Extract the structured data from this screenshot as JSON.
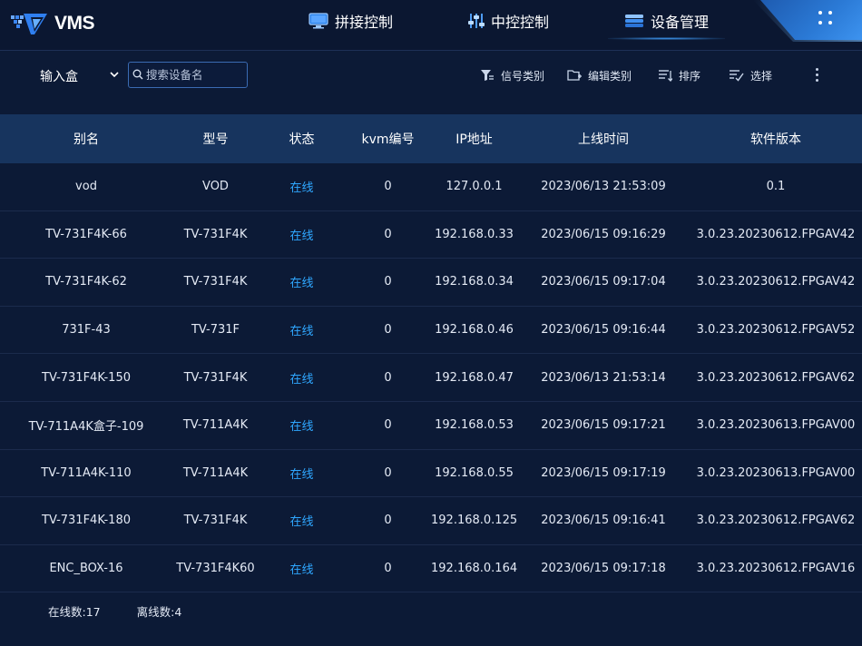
{
  "app": {
    "logo_text": "VMS"
  },
  "nav": {
    "tabs": [
      {
        "label": "拼接控制",
        "icon": "monitor-icon",
        "active": false
      },
      {
        "label": "中控控制",
        "icon": "sliders-icon",
        "active": false
      },
      {
        "label": "设备管理",
        "icon": "device-stack-icon",
        "active": true
      }
    ]
  },
  "toolbar": {
    "select_value": "输入盒",
    "search_placeholder": "搜索设备名",
    "signal_category": "信号类别",
    "edit_category": "编辑类别",
    "sort": "排序",
    "select": "选择"
  },
  "table": {
    "headers": [
      "别名",
      "型号",
      "状态",
      "kvm编号",
      "IP地址",
      "上线时间",
      "软件版本"
    ],
    "rows": [
      {
        "alias": "vod",
        "model": "VOD",
        "status": "在线",
        "kvm": "0",
        "ip": "127.0.0.1",
        "online_time": "2023/06/13 21:53:09",
        "version": "0.1"
      },
      {
        "alias": "TV-731F4K-66",
        "model": "TV-731F4K",
        "status": "在线",
        "kvm": "0",
        "ip": "192.168.0.33",
        "online_time": "2023/06/15 09:16:29",
        "version": "3.0.23.20230612.FPGAV42"
      },
      {
        "alias": "TV-731F4K-62",
        "model": "TV-731F4K",
        "status": "在线",
        "kvm": "0",
        "ip": "192.168.0.34",
        "online_time": "2023/06/15 09:17:04",
        "version": "3.0.23.20230612.FPGAV42"
      },
      {
        "alias": "731F-43",
        "model": "TV-731F",
        "status": "在线",
        "kvm": "0",
        "ip": "192.168.0.46",
        "online_time": "2023/06/15 09:16:44",
        "version": "3.0.23.20230612.FPGAV52"
      },
      {
        "alias": "TV-731F4K-150",
        "model": "TV-731F4K",
        "status": "在线",
        "kvm": "0",
        "ip": "192.168.0.47",
        "online_time": "2023/06/13 21:53:14",
        "version": "3.0.23.20230612.FPGAV62"
      },
      {
        "alias": "TV-711A4K盒子-109",
        "model": "TV-711A4K",
        "status": "在线",
        "kvm": "0",
        "ip": "192.168.0.53",
        "online_time": "2023/06/15 09:17:21",
        "version": "3.0.23.20230613.FPGAV00"
      },
      {
        "alias": "TV-711A4K-110",
        "model": "TV-711A4K",
        "status": "在线",
        "kvm": "0",
        "ip": "192.168.0.55",
        "online_time": "2023/06/15 09:17:19",
        "version": "3.0.23.20230613.FPGAV00"
      },
      {
        "alias": "TV-731F4K-180",
        "model": "TV-731F4K",
        "status": "在线",
        "kvm": "0",
        "ip": "192.168.0.125",
        "online_time": "2023/06/15 09:16:41",
        "version": "3.0.23.20230612.FPGAV62"
      },
      {
        "alias": "ENC_BOX-16",
        "model": "TV-731F4K60",
        "status": "在线",
        "kvm": "0",
        "ip": "192.168.0.164",
        "online_time": "2023/06/15 09:17:18",
        "version": "3.0.23.20230612.FPGAV16"
      }
    ]
  },
  "footer": {
    "online_count": "在线数:17",
    "offline_count": "离线数:4"
  },
  "colors": {
    "background": "#0c1a36",
    "header_row": "#17345e",
    "online_status": "#2fa7ff",
    "accent": "#2b7ad6"
  }
}
